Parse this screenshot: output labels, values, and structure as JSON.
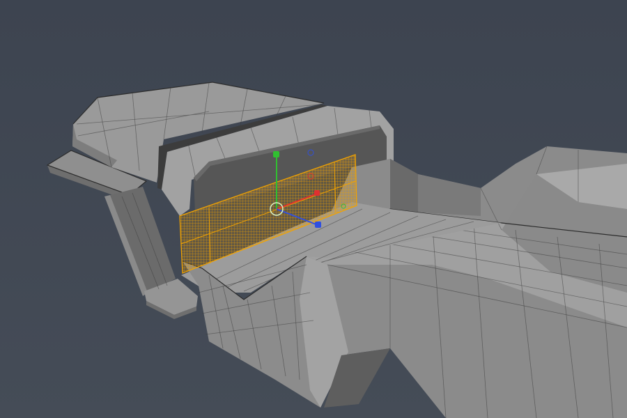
{
  "viewport": {
    "name": "3d-viewport",
    "background": "#40464f",
    "model": {
      "name": "hard-surface-vehicle-body",
      "display": "wireframe-on-shaded"
    },
    "selection": {
      "type": "faces",
      "color": "#f2a300"
    },
    "gizmo": {
      "mode": "move",
      "axes": {
        "x": {
          "color": "#e03030"
        },
        "y": {
          "color": "#30c030"
        },
        "z": {
          "color": "#3050e0"
        }
      },
      "center_color": "#d8f0c0"
    }
  }
}
